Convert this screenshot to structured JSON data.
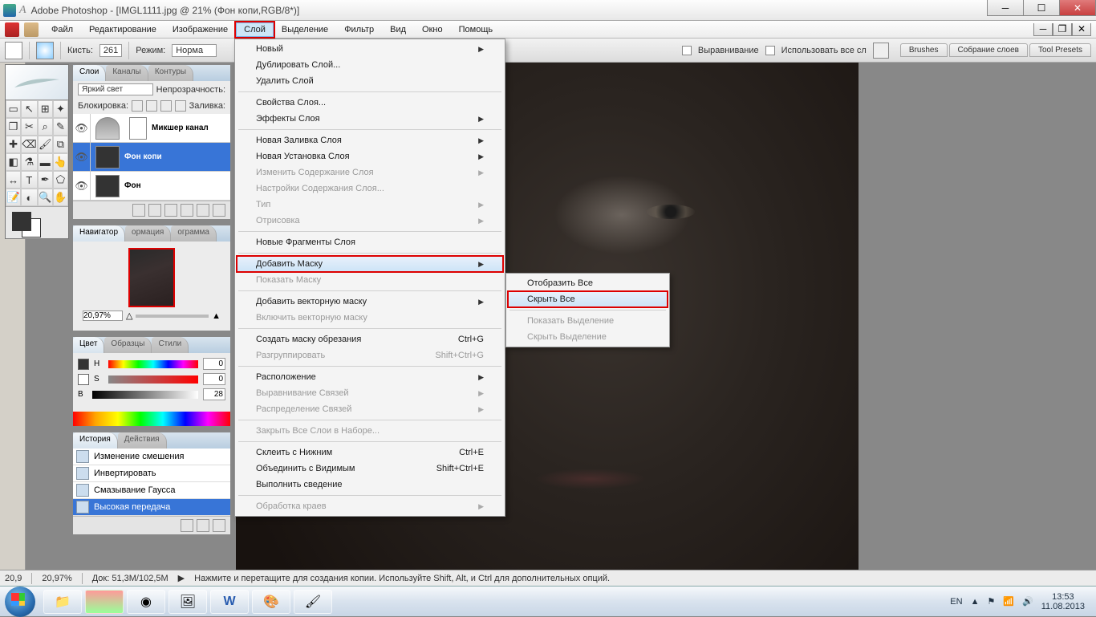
{
  "title": "Adobe Photoshop - [IMGL1111.jpg @ 21% (Фон копи,RGB/8*)]",
  "menubar": [
    "Файл",
    "Редактирование",
    "Изображение",
    "Слой",
    "Выделение",
    "Фильтр",
    "Вид",
    "Окно",
    "Помощь"
  ],
  "menubar_open_index": 3,
  "optbar": {
    "brush_label": "Кисть:",
    "brush_size": "261",
    "mode_label": "Режим:",
    "mode_value": "Норма",
    "align_label": "Выравнивание",
    "useall_label": "Использовать все сл",
    "tabs": [
      "Brushes",
      "Собрание слоев",
      "Tool Presets"
    ]
  },
  "layers_panel": {
    "tabs": [
      "Слои",
      "Каналы",
      "Контуры"
    ],
    "blend_label": "Яркий свет",
    "opacity_label": "Непрозрачность:",
    "lock_label": "Блокировка:",
    "fill_label": "Заливка:",
    "layers": [
      {
        "name": "Микшер канал",
        "sel": false,
        "mixer": true
      },
      {
        "name": "Фон копи",
        "sel": true
      },
      {
        "name": "Фон",
        "sel": false
      }
    ]
  },
  "navigator": {
    "tabs": [
      "Навигатор",
      "ормация",
      "ограмма"
    ],
    "zoom": "20,97%"
  },
  "color_panel": {
    "tabs": [
      "Цвет",
      "Образцы",
      "Стили"
    ],
    "rows": [
      {
        "lbl": "H",
        "val": "0"
      },
      {
        "lbl": "S",
        "val": "0"
      },
      {
        "lbl": "B",
        "val": "28"
      }
    ]
  },
  "history_panel": {
    "tabs": [
      "История",
      "Действия"
    ],
    "items": [
      {
        "name": "Изменение смешения",
        "sel": false
      },
      {
        "name": "Инвертировать",
        "sel": false
      },
      {
        "name": "Смазывание Гаусса",
        "sel": false
      },
      {
        "name": "Высокая передача",
        "sel": true
      }
    ]
  },
  "dropdown": [
    {
      "t": "Новый",
      "arrow": true
    },
    {
      "t": "Дублировать Слой..."
    },
    {
      "t": "Удалить Слой"
    },
    {
      "sep": true
    },
    {
      "t": "Свойства Слоя..."
    },
    {
      "t": "Эффекты Слоя",
      "arrow": true
    },
    {
      "sep": true
    },
    {
      "t": "Новая Заливка Слоя",
      "arrow": true
    },
    {
      "t": "Новая Установка Слоя",
      "arrow": true
    },
    {
      "t": "Изменить Содержание Слоя",
      "arrow": true,
      "disabled": true
    },
    {
      "t": "Настройки Содержания Слоя...",
      "disabled": true
    },
    {
      "t": "Тип",
      "arrow": true,
      "disabled": true
    },
    {
      "t": "Отрисовка",
      "arrow": true,
      "disabled": true
    },
    {
      "sep": true
    },
    {
      "t": "Новые Фрагменты Слоя"
    },
    {
      "sep": true
    },
    {
      "t": "Добавить Маску",
      "arrow": true,
      "hover": true,
      "hred": true
    },
    {
      "t": "Показать Маску",
      "disabled": true
    },
    {
      "sep": true
    },
    {
      "t": "Добавить векторную маску",
      "arrow": true
    },
    {
      "t": "Включить векторную маску",
      "disabled": true
    },
    {
      "sep": true
    },
    {
      "t": "Создать маску обрезания",
      "sc": "Ctrl+G"
    },
    {
      "t": "Разгруппировать",
      "sc": "Shift+Ctrl+G",
      "disabled": true
    },
    {
      "sep": true
    },
    {
      "t": "Расположение",
      "arrow": true
    },
    {
      "t": "Выравнивание Связей",
      "arrow": true,
      "disabled": true
    },
    {
      "t": "Распределение Связей",
      "arrow": true,
      "disabled": true
    },
    {
      "sep": true
    },
    {
      "t": "Закрыть Все Слои в Наборе...",
      "disabled": true
    },
    {
      "sep": true
    },
    {
      "t": "Склеить с Нижним",
      "sc": "Ctrl+E"
    },
    {
      "t": "Объединить с Видимым",
      "sc": "Shift+Ctrl+E"
    },
    {
      "t": "Выполнить сведение"
    },
    {
      "sep": true
    },
    {
      "t": "Обработка краев",
      "arrow": true,
      "disabled": true
    }
  ],
  "submenu": [
    {
      "t": "Отобразить Все"
    },
    {
      "t": "Скрыть Все",
      "hover": true,
      "hred": true
    },
    {
      "sep": true
    },
    {
      "t": "Показать Выделение",
      "disabled": true
    },
    {
      "t": "Скрыть Выделение",
      "disabled": true
    }
  ],
  "statusbar": {
    "z1": "20,9",
    "z2": "20,97%",
    "doc": "Док: 51,3M/102,5M",
    "hint": "Нажмите и перетащите для создания копии.  Используйте Shift, Alt, и Ctrl для дополнительных опций."
  },
  "tray": {
    "lang": "EN",
    "time": "13:53",
    "date": "11.08.2013"
  }
}
